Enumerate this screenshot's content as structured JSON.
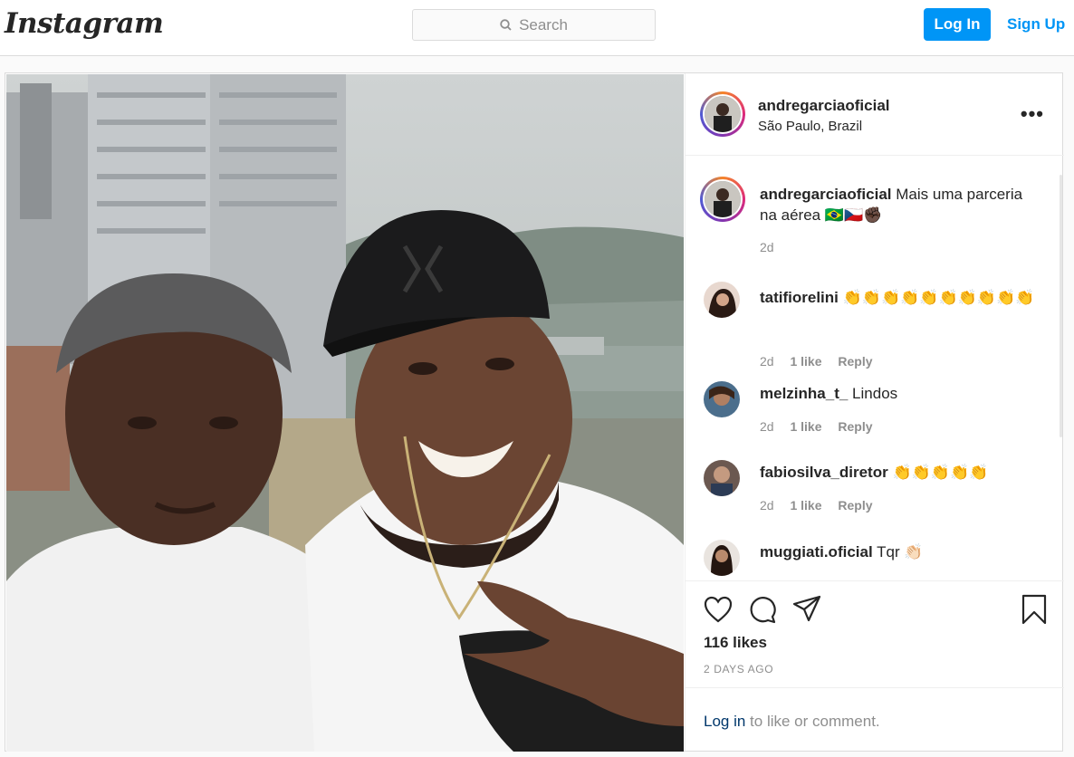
{
  "header": {
    "logo": "Instagram",
    "search_placeholder": "Search",
    "login_label": "Log In",
    "signup_label": "Sign Up"
  },
  "post": {
    "author": "andregarciaoficial",
    "location": "São Paulo, Brazil",
    "caption_author": "andregarciaoficial",
    "caption_text": "Mais uma parceria na aérea 🇧🇷🇨🇿✊🏿",
    "caption_time": "2d",
    "likes": "116 likes",
    "time_ago": "2 DAYS AGO"
  },
  "comments": [
    {
      "user": "tatifiorelini",
      "text": "👏👏👏👏👏👏👏👏👏👏",
      "time": "2d",
      "likes": "1 like",
      "reply": "Reply"
    },
    {
      "user": "melzinha_t_",
      "text": "Lindos",
      "time": "2d",
      "likes": "1 like",
      "reply": "Reply"
    },
    {
      "user": "fabiosilva_diretor",
      "text": "👏👏👏👏👏",
      "time": "2d",
      "likes": "1 like",
      "reply": "Reply"
    },
    {
      "user": "muggiati.oficial",
      "text": "Tqr 👏🏻",
      "time": "",
      "likes": "",
      "reply": ""
    }
  ],
  "footer": {
    "login_link": "Log in",
    "rest": " to like or comment."
  },
  "icons": [
    "search-icon",
    "more-icon",
    "heart-icon",
    "comment-icon",
    "share-icon",
    "bookmark-icon"
  ],
  "colors": {
    "accent": "#0095f6",
    "text": "#262626",
    "muted": "#8e8e8e"
  }
}
